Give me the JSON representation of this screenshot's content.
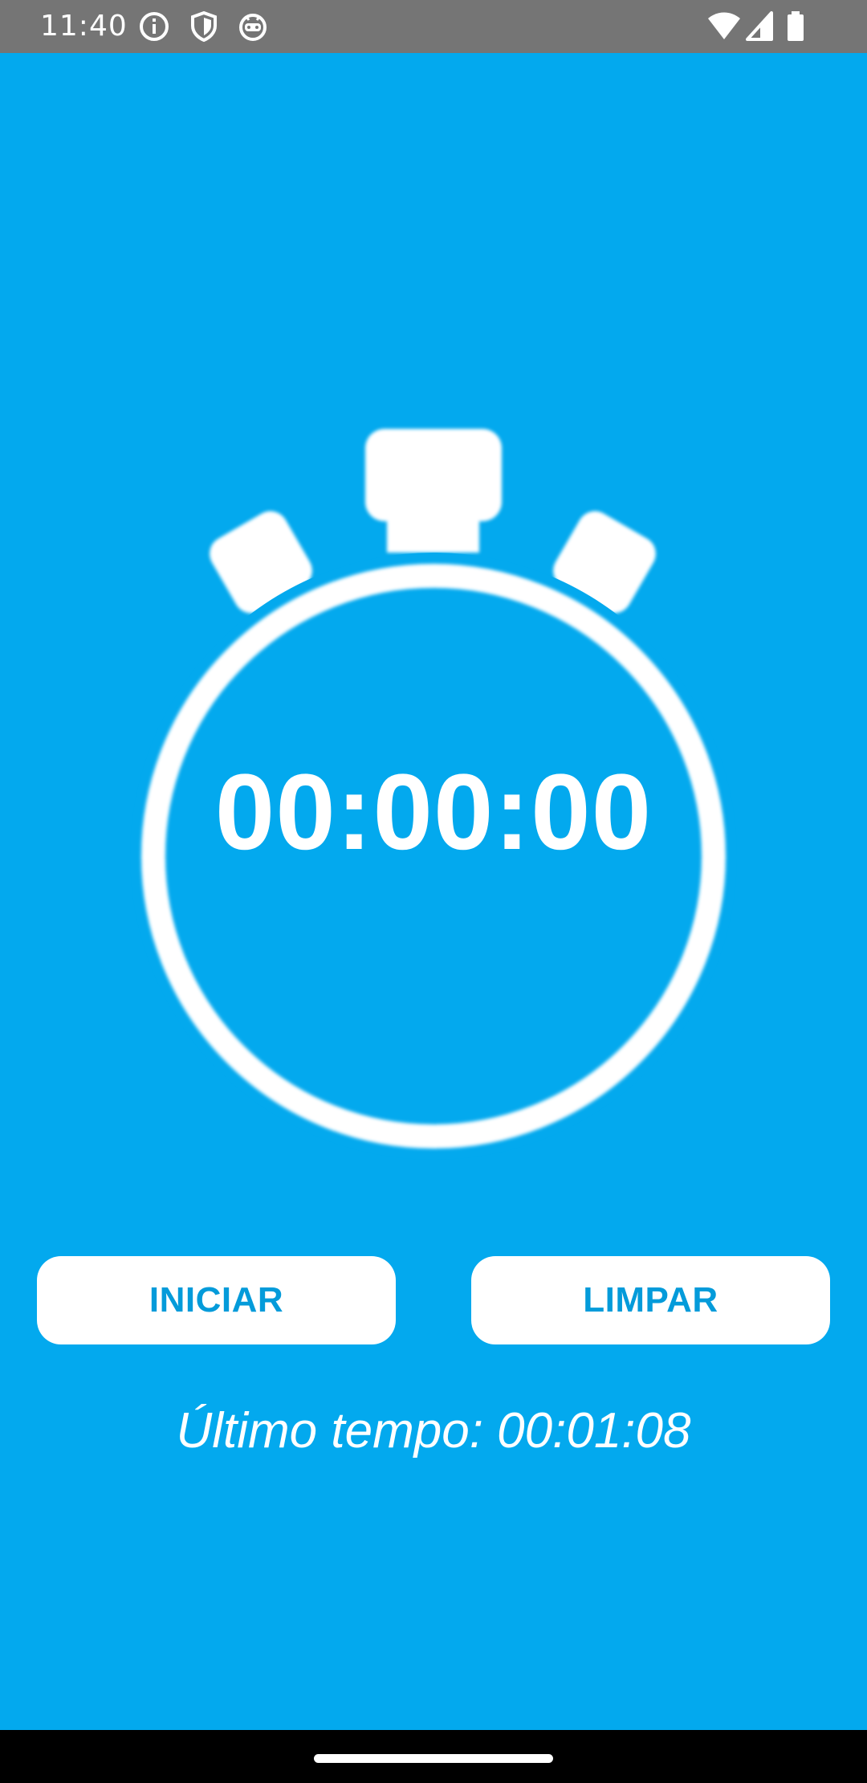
{
  "status_bar": {
    "time": "11:40",
    "left_icons": [
      "info-icon",
      "shield-icon",
      "android-debug-icon"
    ],
    "right_icons": [
      "wifi-icon",
      "cellular-signal-icon",
      "battery-icon"
    ]
  },
  "stopwatch": {
    "icon": "stopwatch-icon",
    "display": "00:00:00"
  },
  "buttons": {
    "start_label": "INICIAR",
    "clear_label": "LIMPAR"
  },
  "last_time": {
    "text": "Último tempo: 00:01:08"
  },
  "colors": {
    "background": "#03A9EE",
    "button_text": "#049BDA",
    "status_bar": "#757575",
    "nav_bar": "#000000"
  }
}
